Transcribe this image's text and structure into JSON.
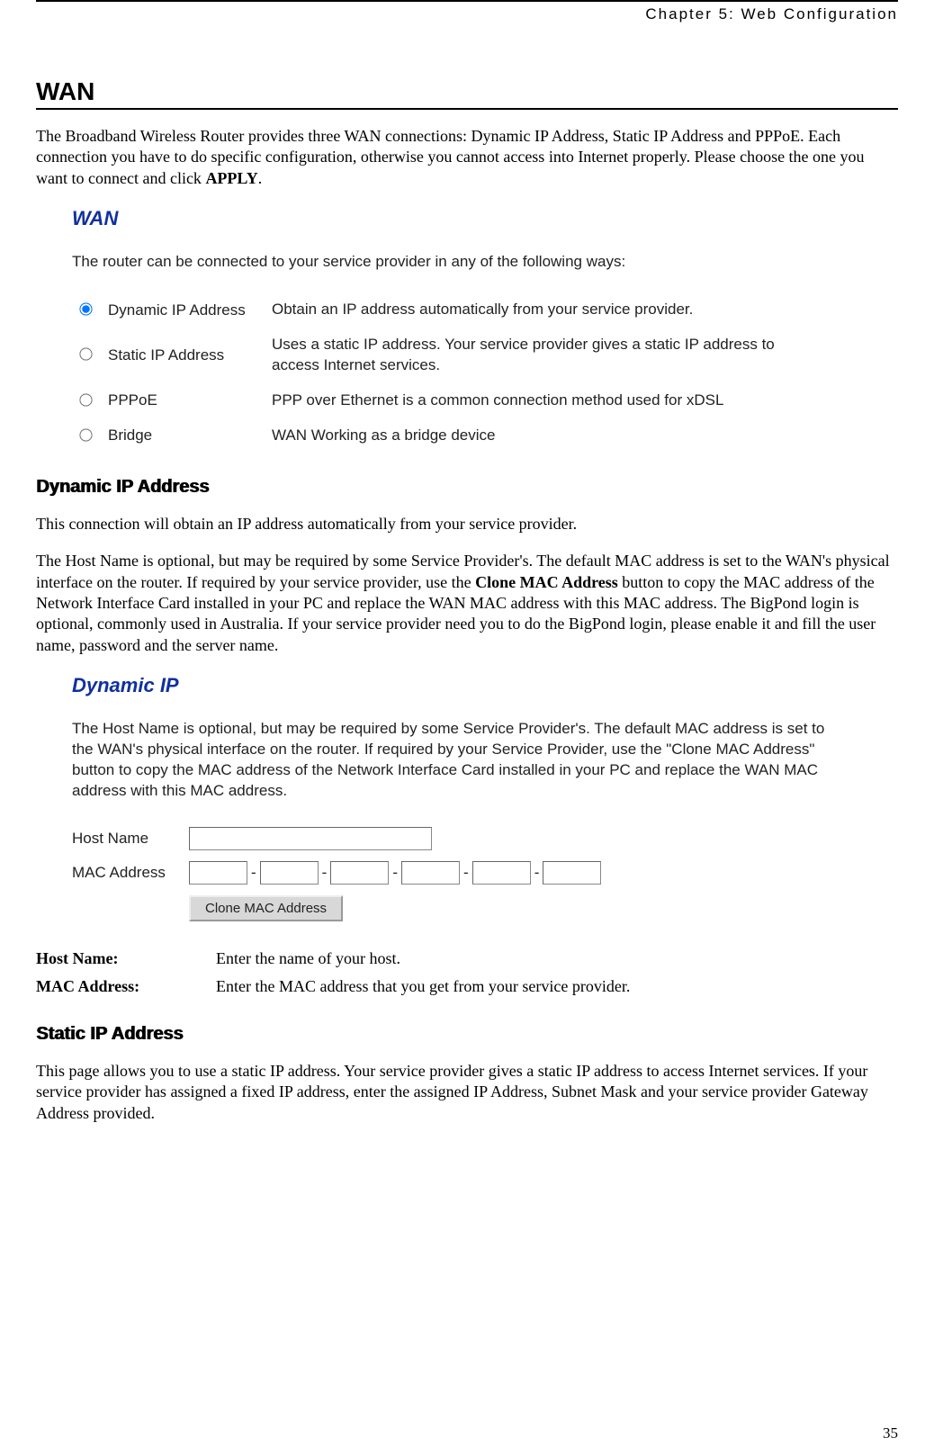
{
  "header": {
    "chapter": "Chapter 5: Web Configuration"
  },
  "body": {
    "h1": "WAN",
    "intro_a": "The Broadband Wireless Router provides three WAN connections: Dynamic IP Address, Static IP Address and PPPoE. Each connection you have to do specific configuration, otherwise you cannot access into Internet properly. Please choose the one you want to connect and click ",
    "intro_bold": "APPLY",
    "intro_b": "."
  },
  "wan_shot": {
    "title": "WAN",
    "intro": "The router can be connected to your service provider in any of the following ways:",
    "options": [
      {
        "label": "Dynamic IP Address",
        "desc": "Obtain an IP address automatically from your service provider.",
        "checked": true
      },
      {
        "label": "Static IP Address",
        "desc": "Uses a static IP address. Your service provider gives a static IP address to access Internet services.",
        "checked": false
      },
      {
        "label": "PPPoE",
        "desc": "PPP over Ethernet is a common connection method used for xDSL",
        "checked": false
      },
      {
        "label": "Bridge",
        "desc": "WAN Working as a bridge device",
        "checked": false
      }
    ]
  },
  "dyn_section": {
    "heading": "Dynamic IP Address",
    "p1": "This connection will obtain an IP address automatically from your service provider.",
    "p2_a": "The Host Name is optional, but may be required by some Service Provider's. The default MAC address is set to the WAN's physical interface on the router. If required by your service provider, use the ",
    "p2_bold": "Clone MAC Address",
    "p2_b": " button to copy the MAC address of the Network Interface Card installed in your PC and replace the WAN MAC address with this MAC address. The BigPond login is optional, commonly used in Australia. If your service provider need you to do the BigPond login, please enable it and fill the user name, password and the server name."
  },
  "dyn_shot": {
    "title": "Dynamic IP",
    "intro": "The Host Name is optional, but may be required by some Service Provider's. The default MAC address is set to the WAN's physical interface on the router. If required by your Service Provider, use the \"Clone MAC Address\" button to copy the MAC address of the Network Interface Card installed in your PC and replace the WAN MAC address with this MAC address.",
    "host_label": "Host Name",
    "mac_label": "MAC Address",
    "button": "Clone MAC Address",
    "host_value": "",
    "mac": [
      "",
      "",
      "",
      "",
      "",
      ""
    ]
  },
  "field_desc": {
    "host_name_label": "Host Name:",
    "host_name_desc": "Enter the name of your host.",
    "mac_label": "MAC Address:",
    "mac_desc": "Enter the MAC address that you get from your service provider."
  },
  "static_section": {
    "heading": "Static IP Address",
    "p1": "This page allows you to use a static IP address. Your service provider gives a static IP address to access Internet services. If your service provider has assigned a fixed IP address, enter the assigned IP Address, Subnet Mask and your service provider Gateway Address provided."
  },
  "page_number": "35"
}
